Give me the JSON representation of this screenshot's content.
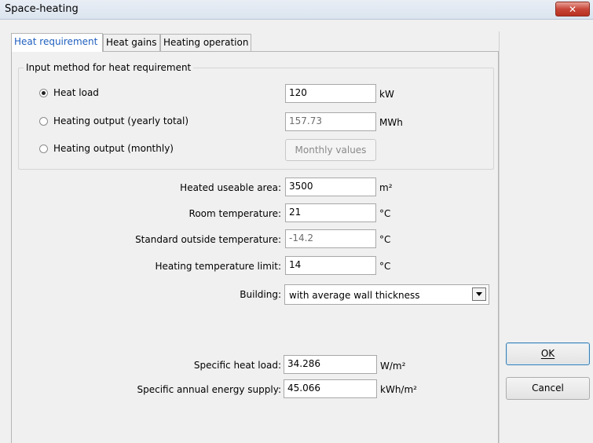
{
  "window": {
    "title": "Space-heating",
    "close_icon": "close-icon"
  },
  "tabs": [
    {
      "label": "Heat requirement",
      "active": true
    },
    {
      "label": "Heat gains",
      "active": false
    },
    {
      "label": "Heating operation",
      "active": false
    }
  ],
  "input_method": {
    "title": "Input method for heat requirement",
    "options": [
      {
        "label": "Heat load",
        "selected": true,
        "value": "120",
        "unit": "kW"
      },
      {
        "label": "Heating output (yearly total)",
        "selected": false,
        "value": "157.73",
        "unit": "MWh"
      },
      {
        "label": "Heating output (monthly)",
        "selected": false,
        "button": "Monthly values"
      }
    ]
  },
  "fields": {
    "heated_area": {
      "label": "Heated useable area:",
      "value": "3500",
      "unit": "m²"
    },
    "room_temp": {
      "label": "Room temperature:",
      "value": "21",
      "unit": "°C"
    },
    "outside_temp": {
      "label": "Standard outside temperature:",
      "value": "-14.2",
      "unit": "°C"
    },
    "temp_limit": {
      "label": "Heating temperature limit:",
      "value": "14",
      "unit": "°C"
    },
    "building": {
      "label": "Building:",
      "value": "with average wall thickness"
    },
    "specific_heat_load": {
      "label": "Specific heat load:",
      "value": "34.286",
      "unit": "W/m²"
    },
    "annual_energy": {
      "label": "Specific annual energy supply:",
      "value": "45.066",
      "unit": "kWh/m²"
    }
  },
  "buttons": {
    "ok": "OK",
    "cancel": "Cancel"
  }
}
